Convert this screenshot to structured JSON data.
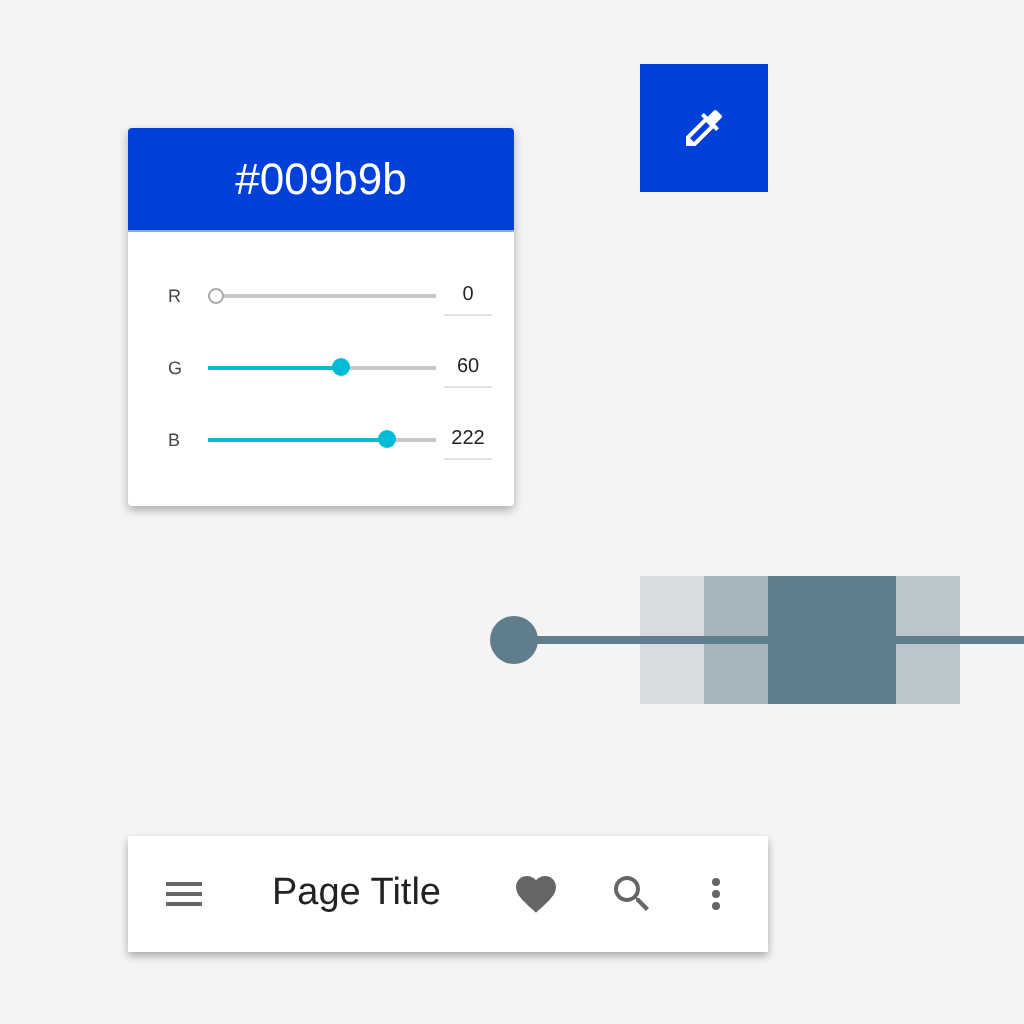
{
  "color_card": {
    "hex": "#009b9b",
    "channels": [
      {
        "label": "R",
        "level": 0,
        "value": "0"
      },
      {
        "label": "G",
        "level": 0.58,
        "value": "60"
      },
      {
        "label": "B",
        "level": 0.78,
        "value": "222"
      }
    ]
  },
  "swatches": [
    {
      "color": "#d6dce0"
    },
    {
      "color": "#a6b6bc"
    },
    {
      "color": "#607d8b"
    },
    {
      "color": "#b9c6cb"
    }
  ],
  "app_bar": {
    "title": "Page Title"
  }
}
